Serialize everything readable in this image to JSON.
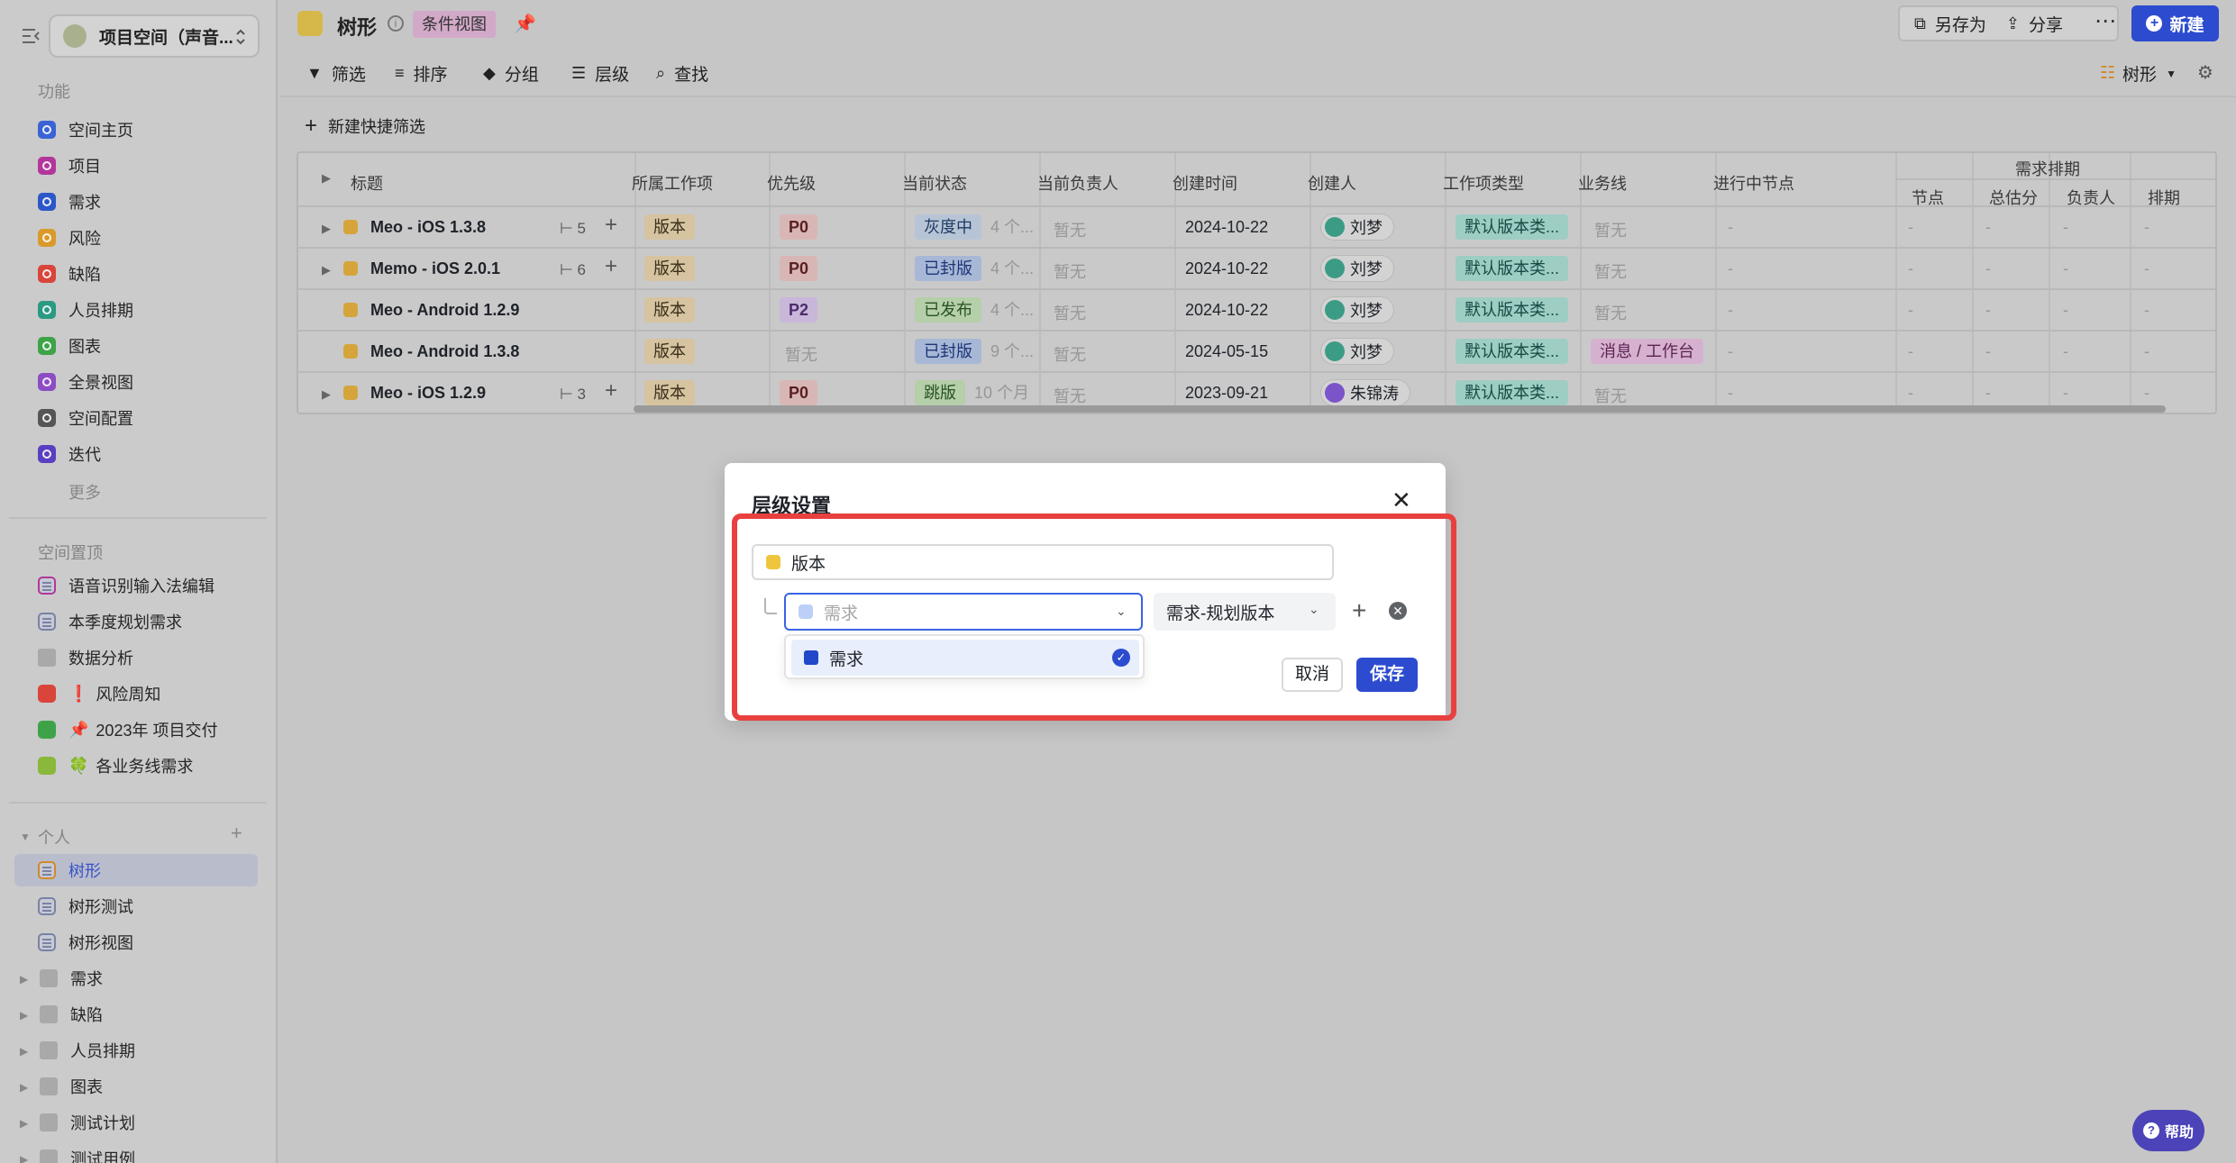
{
  "sidebar": {
    "space_name": "项目空间（声音...",
    "func_title": "功能",
    "func_items": [
      {
        "label": "空间主页",
        "color": "#3b63d6"
      },
      {
        "label": "项目",
        "color": "#b2379b"
      },
      {
        "label": "需求",
        "color": "#2c57c9"
      },
      {
        "label": "风险",
        "color": "#d99a2b"
      },
      {
        "label": "缺陷",
        "color": "#d9453b"
      },
      {
        "label": "人员排期",
        "color": "#2a9a82"
      },
      {
        "label": "图表",
        "color": "#3ea348"
      },
      {
        "label": "全景视图",
        "color": "#8c4dc4"
      },
      {
        "label": "空间配置",
        "color": "#555555"
      },
      {
        "label": "迭代",
        "color": "#5a3fc0"
      }
    ],
    "more_label": "更多",
    "pinned_title": "空间置顶",
    "pinned_items": [
      {
        "label": "语音识别输入法编辑",
        "prefix": ""
      },
      {
        "label": "本季度规划需求",
        "prefix": ""
      },
      {
        "label": "数据分析",
        "prefix": ""
      },
      {
        "label": "风险周知",
        "prefix": "❗"
      },
      {
        "label": "2023年 项目交付",
        "prefix": "📌"
      },
      {
        "label": "各业务线需求",
        "prefix": "🍀"
      }
    ],
    "personal_title": "个人",
    "personal_views": [
      "树形",
      "树形测试",
      "树形视图"
    ],
    "folders": [
      "需求",
      "缺陷",
      "人员排期",
      "图表",
      "测试计划",
      "测试用例"
    ]
  },
  "header": {
    "title": "树形",
    "badge": "条件视图",
    "save_as": "另存为",
    "share": "分享",
    "new": "新建"
  },
  "toolbar": {
    "filter": "筛选",
    "sort": "排序",
    "group": "分组",
    "level": "层级",
    "find": "查找",
    "view_mode": "树形",
    "quick_filter": "新建快捷筛选"
  },
  "table": {
    "columns": [
      "标题",
      "所属工作项",
      "优先级",
      "当前状态",
      "当前负责人",
      "创建时间",
      "创建人",
      "工作项类型",
      "业务线",
      "进行中节点"
    ],
    "group_header": "需求排期",
    "sub_columns": [
      "节点",
      "总估分",
      "负责人",
      "排期"
    ],
    "rows": [
      {
        "title": "Meo - iOS 1.3.8",
        "children": "5",
        "item": "版本",
        "priority": "P0",
        "status": "灰度中",
        "status_time": "4 个...",
        "owner": "暂无",
        "created": "2024-10-22",
        "creator": "刘梦",
        "type": "默认版本类...",
        "biz": "暂无",
        "node": "-",
        "s1": "-",
        "s2": "-",
        "s3": "-",
        "s4": "-"
      },
      {
        "title": "Memo - iOS 2.0.1",
        "children": "6",
        "item": "版本",
        "priority": "P0",
        "status": "已封版",
        "status_time": "4 个...",
        "owner": "暂无",
        "created": "2024-10-22",
        "creator": "刘梦",
        "type": "默认版本类...",
        "biz": "暂无",
        "node": "-",
        "s1": "-",
        "s2": "-",
        "s3": "-",
        "s4": "-"
      },
      {
        "title": "Meo - Android 1.2.9",
        "children": "",
        "item": "版本",
        "priority": "P2",
        "status": "已发布",
        "status_time": "4 个...",
        "owner": "暂无",
        "created": "2024-10-22",
        "creator": "刘梦",
        "type": "默认版本类...",
        "biz": "暂无",
        "node": "-",
        "s1": "-",
        "s2": "-",
        "s3": "-",
        "s4": "-"
      },
      {
        "title": "Meo - Android 1.3.8",
        "children": "",
        "item": "版本",
        "priority": "暂无",
        "status": "已封版",
        "status_time": "9 个...",
        "owner": "暂无",
        "created": "2024-05-15",
        "creator": "刘梦",
        "type": "默认版本类...",
        "biz": "消息 / 工作台",
        "node": "-",
        "s1": "-",
        "s2": "-",
        "s3": "-",
        "s4": "-"
      },
      {
        "title": "Meo - iOS 1.2.9",
        "children": "3",
        "item": "版本",
        "priority": "P0",
        "status": "跳版",
        "status_time": "10 个月",
        "owner": "暂无",
        "created": "2023-09-21",
        "creator": "朱锦涛",
        "type": "默认版本类...",
        "biz": "暂无",
        "node": "-",
        "s1": "-",
        "s2": "-",
        "s3": "-",
        "s4": "-"
      }
    ]
  },
  "modal": {
    "title": "层级设置",
    "level1": "版本",
    "level2_placeholder": "需求",
    "relation": "需求-规划版本",
    "option": "需求",
    "cancel": "取消",
    "save": "保存"
  },
  "help": "帮助"
}
